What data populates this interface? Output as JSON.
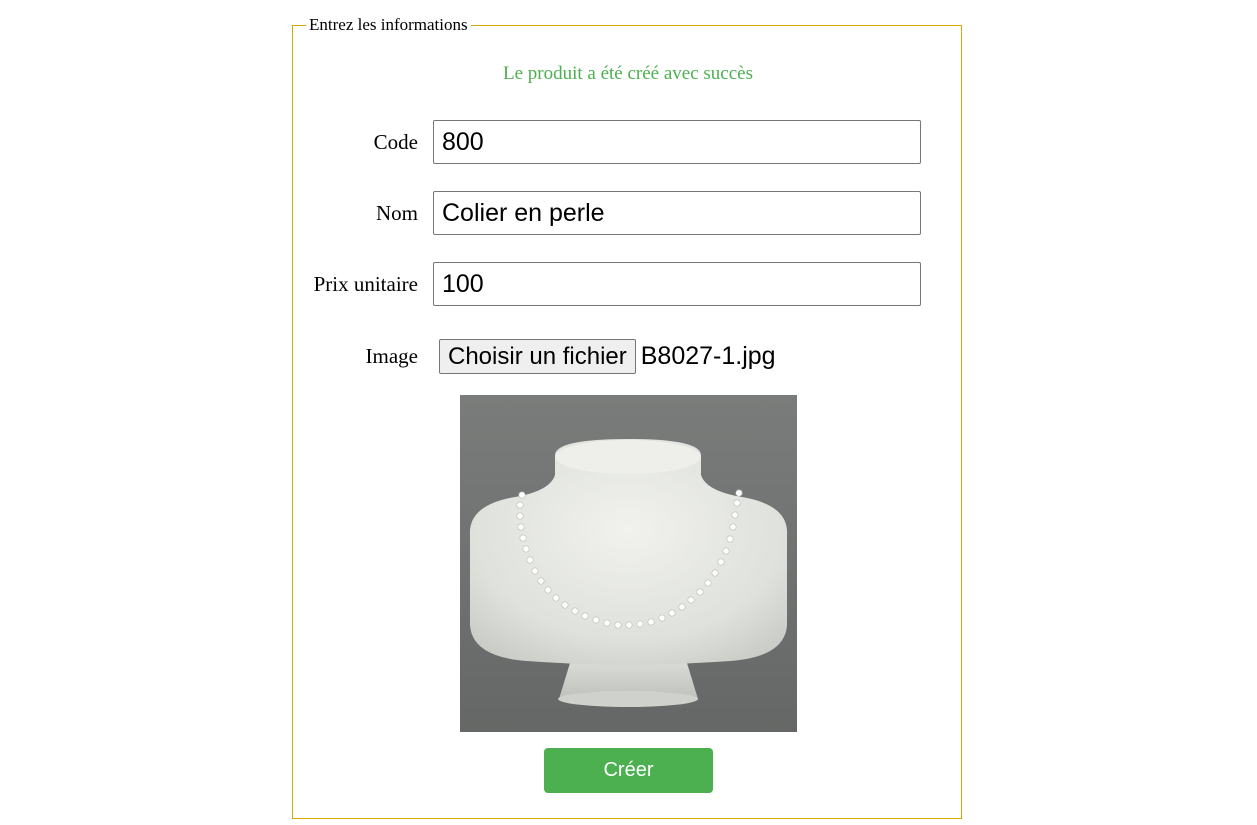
{
  "form": {
    "legend": "Entrez les informations",
    "success_message": "Le produit a été créé avec succès",
    "fields": {
      "code": {
        "label": "Code",
        "value": "800"
      },
      "nom": {
        "label": "Nom",
        "value": "Colier en perle"
      },
      "prix": {
        "label": "Prix unitaire",
        "value": "100"
      },
      "image": {
        "label": "Image",
        "button_label": "Choisir un fichier",
        "file_name": "B8027-1.jpg"
      }
    },
    "submit_label": "Créer"
  },
  "colors": {
    "fieldset_border": "#d4a900",
    "success_text": "#4caf50",
    "submit_bg": "#4caf50"
  },
  "icons": {
    "product_image": "pearl-necklace-on-bust"
  }
}
